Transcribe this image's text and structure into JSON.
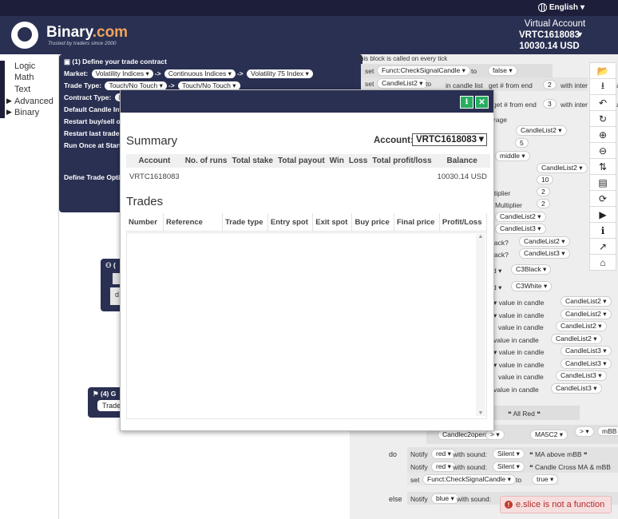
{
  "topbar": {
    "language": "English",
    "caret": "▾"
  },
  "brand": {
    "name": "Binary",
    "suffix": ".com",
    "tagline": "Trusted by traders since 2000"
  },
  "account": {
    "title": "Virtual Account",
    "id": "VRTC1618083",
    "balance": "10030.14 USD"
  },
  "toolbox": {
    "items": [
      {
        "label": "Logic",
        "expandable": false
      },
      {
        "label": "Math",
        "expandable": false
      },
      {
        "label": "Text",
        "expandable": false
      },
      {
        "label": "Advanced",
        "expandable": true
      },
      {
        "label": "Binary",
        "expandable": true
      }
    ]
  },
  "trade_block": {
    "title": "(1) Define your trade contract",
    "market_label": "Market:",
    "market": "Volatility Indices",
    "submarket": "Continuous Indices",
    "symbol": "Volatility 75 Index",
    "arrow": "->",
    "trade_type_label": "Trade Type:",
    "trade_type": "Touch/No Touch",
    "trade_type2": "Touch/No Touch",
    "contract_type_label": "Contract Type:",
    "contract_type": "Bo",
    "candle_interval": "Default Candle Inte",
    "restart_buysell": "Restart buy/sell or",
    "restart_last": "Restart last trade o",
    "run_once": "Run Once at Start:",
    "define_options": "Define Trade Optio"
  },
  "small_blocks": {
    "block_a_title": "(",
    "block_a_text": "d",
    "block4_title": "(4) G",
    "block4_item": "Trade"
  },
  "right_code": {
    "comment": "This block is called on every tick",
    "set": "set",
    "to": "to",
    "func_check": "Funct:CheckSignalCandle",
    "false_val": "false",
    "true_val": "true",
    "candlelist2": "CandleList2",
    "candlelist3": "CandleList3",
    "in_candle_list": "in candle list",
    "get_from_end": "get # from end",
    "n2": "2",
    "n3": "3",
    "with_interval": "with inter",
    "interval_suffix": "efa",
    "average": "rage",
    "five": "5",
    "middle": "middle",
    "ten": "10",
    "multiplier": "ltiplier",
    "multiplier_full": "Multiplier",
    "black_q": "lack?",
    "c3black": "C3Black",
    "c3white": "C3White",
    "d_frag": "d",
    "value_in_candle": "value in candle",
    "all_red": "All Red",
    "candlec2open": "Candlec2open",
    "gt": ">",
    "ma5c2": "MA5C2",
    "mbb": "mBB",
    "do_label": "do",
    "else_label": "else",
    "notify": "Notify",
    "red": "red",
    "blue": "blue",
    "with_sound": "with sound:",
    "silent": "Silent",
    "msg1": "MA above mBB",
    "msg2": "Candle Cross MA & mBB",
    "quote": "❝"
  },
  "right_toolbar": {
    "icons": [
      "folder-open-icon",
      "download-icon",
      "undo-icon",
      "redo-icon",
      "zoom-in-icon",
      "zoom-out-icon",
      "sort-icon",
      "file-icon",
      "refresh-icon",
      "play-icon",
      "info-icon",
      "chart-icon",
      "bank-icon"
    ]
  },
  "modal": {
    "summary_title": "Summary",
    "account_label": "Account:",
    "account_selected": "VRTC1618083",
    "summary_headers": [
      "Account",
      "No. of runs",
      "Total stake",
      "Total payout",
      "Win",
      "Loss",
      "Total profit/loss",
      "Balance"
    ],
    "summary_row": [
      "VRTC1618083",
      "",
      "",
      "",
      "",
      "",
      "",
      "10030.14 USD"
    ],
    "trades_title": "Trades",
    "trades_headers": [
      "Number",
      "Reference",
      "Trade type",
      "Entry spot",
      "Exit spot",
      "Buy price",
      "Final price",
      "Profit/Loss"
    ],
    "accent_color": "#27ae60",
    "header_color": "#2a3052"
  },
  "toast": {
    "message": "e.slice is not a function",
    "color": "#b02c2c"
  }
}
